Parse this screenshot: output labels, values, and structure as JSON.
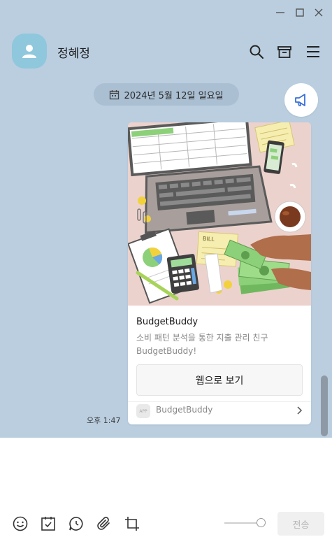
{
  "window": {
    "minimize_icon": "minimize-icon",
    "maximize_icon": "maximize-icon",
    "close_icon": "close-icon"
  },
  "header": {
    "title": "정혜정",
    "avatar_icon": "person-icon",
    "search_icon": "search-icon",
    "archive_icon": "archive-icon",
    "menu_icon": "menu-icon",
    "avatar_color": "#8fc7dc"
  },
  "date_divider": {
    "label": "2024년 5월 12일 일요일",
    "icon": "calendar-icon"
  },
  "notice": {
    "icon": "megaphone-icon"
  },
  "message": {
    "time": "오후 1:47",
    "card": {
      "title": "BudgetBuddy",
      "description": "소비 패턴 분석을 통한 지출 관리 친구 BudgetBuddy!",
      "button_label": "웹으로 보기",
      "footer_app_label": "APP",
      "footer_name": "BudgetBuddy",
      "image_text": {
        "bill": "BILL"
      }
    }
  },
  "composer": {
    "tools": [
      "emoji-icon",
      "schedule-icon",
      "chat-bubble-icon",
      "attach-icon",
      "crop-icon"
    ],
    "send_label": "전송"
  },
  "colors": {
    "background": "#bacee0",
    "card_image_bg": "#ecd2cd",
    "money_green": "#8dd07a"
  }
}
